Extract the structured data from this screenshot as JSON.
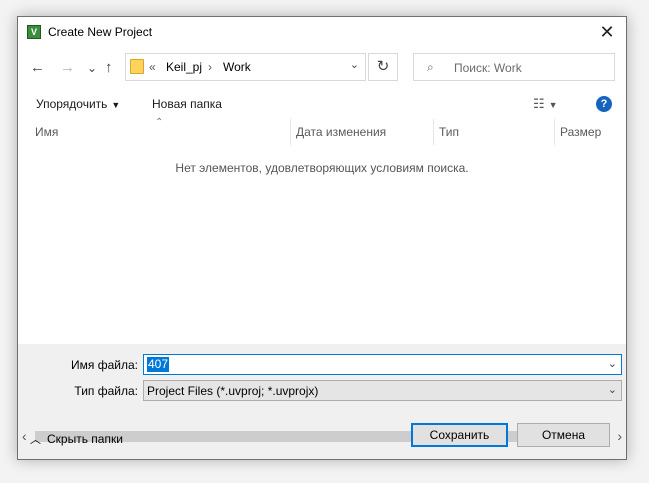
{
  "window": {
    "title": "Create New Project",
    "close_icon": "✕"
  },
  "navigation": {
    "back_icon": "←",
    "forward_icon": "→",
    "recent_icon": "⌄",
    "up_icon": "↑",
    "breadcrumb": [
      "Keil_pj",
      "Work"
    ],
    "overflow_label": "«",
    "separator": "›",
    "refresh_icon": "↻",
    "search_icon": "⌕",
    "search_placeholder": "Поиск: Work"
  },
  "commandbar": {
    "organize_label": "Упорядочить",
    "new_folder_label": "Новая папка",
    "view_icon": "☷",
    "help_icon": "?"
  },
  "file_list": {
    "columns": [
      "Имя",
      "Дата изменения",
      "Тип",
      "Размер"
    ],
    "empty_message": "Нет элементов, удовлетворяющих условиям поиска."
  },
  "form": {
    "filename_label": "Имя файла:",
    "filename_value": "407",
    "filetype_label": "Тип файла:",
    "filetype_value": "Project Files (*.uvproj; *.uvprojx)"
  },
  "footer": {
    "hide_folders_label": "Скрыть папки",
    "save_label": "Сохранить",
    "cancel_label": "Отмена"
  },
  "colors": {
    "accent": "#0078d7",
    "help": "#1565c0",
    "folder": "#ffd35c"
  }
}
